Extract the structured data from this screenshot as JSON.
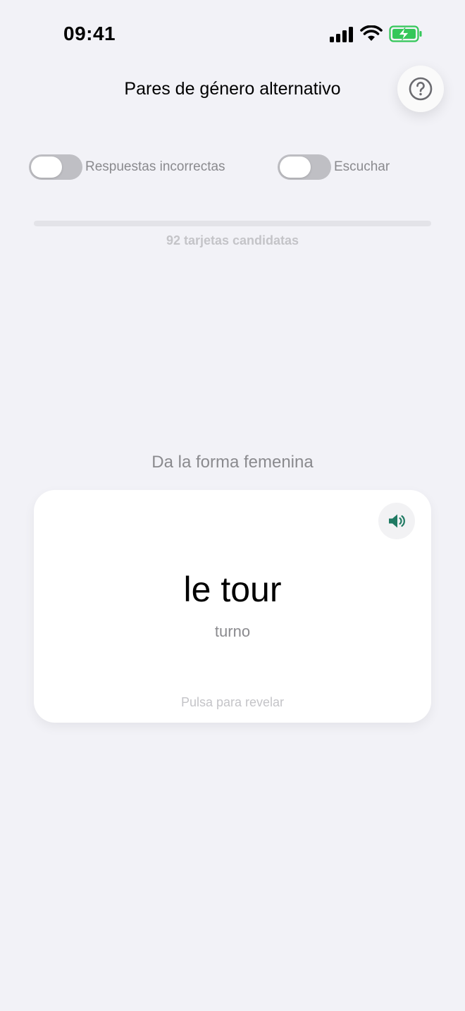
{
  "status_bar": {
    "time": "09:41",
    "signal_icon": "cellular-signal-icon",
    "wifi_icon": "wifi-icon",
    "battery_icon": "battery-charging-icon",
    "battery_color": "#34c759"
  },
  "header": {
    "title": "Pares de género alternativo",
    "help_icon": "question-mark-icon"
  },
  "toggles": [
    {
      "label": "Respuestas incorrectas",
      "on": false
    },
    {
      "label": "Escuchar",
      "on": false
    }
  ],
  "progress": {
    "value": 0,
    "candidates_text": "92 tarjetas candidatas"
  },
  "prompt": "Da la forma femenina",
  "card": {
    "word": "le tour",
    "translation": "turno",
    "hint": "Pulsa para revelar",
    "speaker_icon": "speaker-icon",
    "speaker_color": "#1f7a63"
  },
  "colors": {
    "background": "#f2f2f7",
    "toggle_off": "#bfbfc4",
    "secondary_text": "#8a8a8e"
  }
}
